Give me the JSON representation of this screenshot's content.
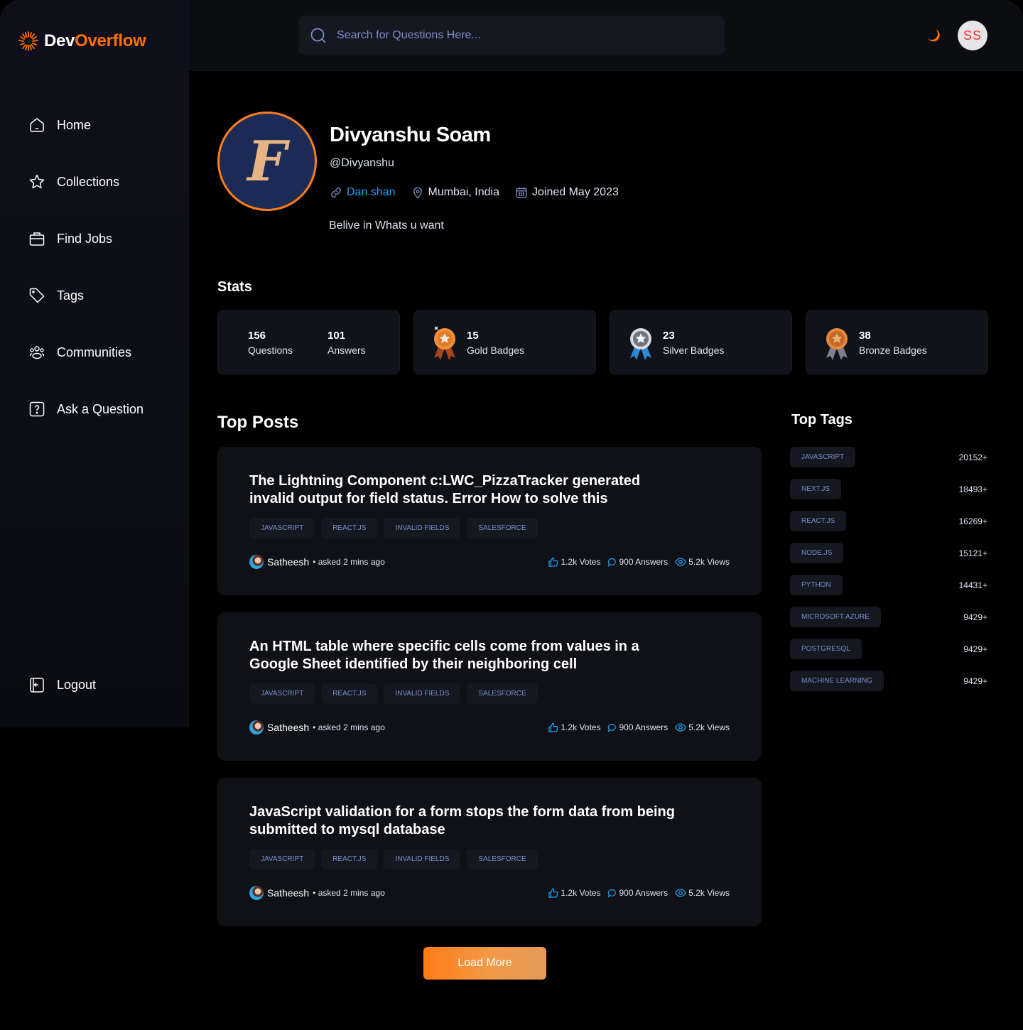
{
  "app": {
    "logo_prefix": "Dev",
    "logo_suffix": "Overflow",
    "accent_color": "#ff7000"
  },
  "header": {
    "search_placeholder": "Search for Questions Here...",
    "theme_icon": "moon-icon",
    "user_initials": "SS"
  },
  "sidebar": {
    "items": [
      {
        "label": "Home",
        "icon": "home-icon"
      },
      {
        "label": "Collections",
        "icon": "star-icon"
      },
      {
        "label": "Find Jobs",
        "icon": "briefcase-icon"
      },
      {
        "label": "Tags",
        "icon": "tag-icon"
      },
      {
        "label": "Communities",
        "icon": "users-icon"
      },
      {
        "label": "Ask a Question",
        "icon": "question-icon"
      }
    ],
    "logout_label": "Logout"
  },
  "profile": {
    "avatar_letter": "F",
    "name": "Divyanshu Soam",
    "handle": "@Divyanshu",
    "link_label": "Dan.shan",
    "location": "Mumbai, India",
    "joined": "Joined May 2023",
    "bio": "Belive in Whats u want"
  },
  "stats": {
    "title": "Stats",
    "questions": {
      "value": "156",
      "label": "Questions"
    },
    "answers": {
      "value": "101",
      "label": "Answers"
    },
    "badges": [
      {
        "value": "15",
        "label": "Gold Badges",
        "icon": "gold-medal-icon"
      },
      {
        "value": "23",
        "label": "Silver Badges",
        "icon": "silver-medal-icon"
      },
      {
        "value": "38",
        "label": "Bronze Badges",
        "icon": "bronze-medal-icon"
      }
    ]
  },
  "top_posts": {
    "title": "Top Posts",
    "posts": [
      {
        "title": "The Lightning Component c:LWC_PizzaTracker generated invalid output for field status. Error How to solve this",
        "tags": [
          "JAVASCRIPT",
          "REACT.JS",
          "INVALID FIELDS",
          "SALESFORCE"
        ],
        "author": "Satheesh",
        "asked": "• asked 2 mins ago",
        "votes": "1.2k Votes",
        "answers": "900 Answers",
        "views": "5.2k Views"
      },
      {
        "title": "An HTML table where specific cells come from values in a Google Sheet identified by their neighboring cell",
        "tags": [
          "JAVASCRIPT",
          "REACT.JS",
          "INVALID FIELDS",
          "SALESFORCE"
        ],
        "author": "Satheesh",
        "asked": "• asked 2 mins ago",
        "votes": "1.2k Votes",
        "answers": "900 Answers",
        "views": "5.2k Views"
      },
      {
        "title": "JavaScript validation for a form stops the form data from being submitted to mysql database",
        "tags": [
          "JAVASCRIPT",
          "REACT.JS",
          "INVALID FIELDS",
          "SALESFORCE"
        ],
        "author": "Satheesh",
        "asked": "• asked 2 mins ago",
        "votes": "1.2k Votes",
        "answers": "900 Answers",
        "views": "5.2k Views"
      }
    ],
    "load_more_label": "Load More"
  },
  "top_tags": {
    "title": "Top Tags",
    "items": [
      {
        "name": "JAVASCRIPT",
        "count": "20152+"
      },
      {
        "name": "NEXT.JS",
        "count": "18493+"
      },
      {
        "name": "REACT.JS",
        "count": "16269+"
      },
      {
        "name": "NODE.JS",
        "count": "15121+"
      },
      {
        "name": "PYTHON",
        "count": "14431+"
      },
      {
        "name": "MICROSOFT AZURE",
        "count": "9429+"
      },
      {
        "name": "POSTGRESQL",
        "count": "9429+"
      },
      {
        "name": "MACHINE LEARNING",
        "count": "9429+"
      }
    ]
  }
}
